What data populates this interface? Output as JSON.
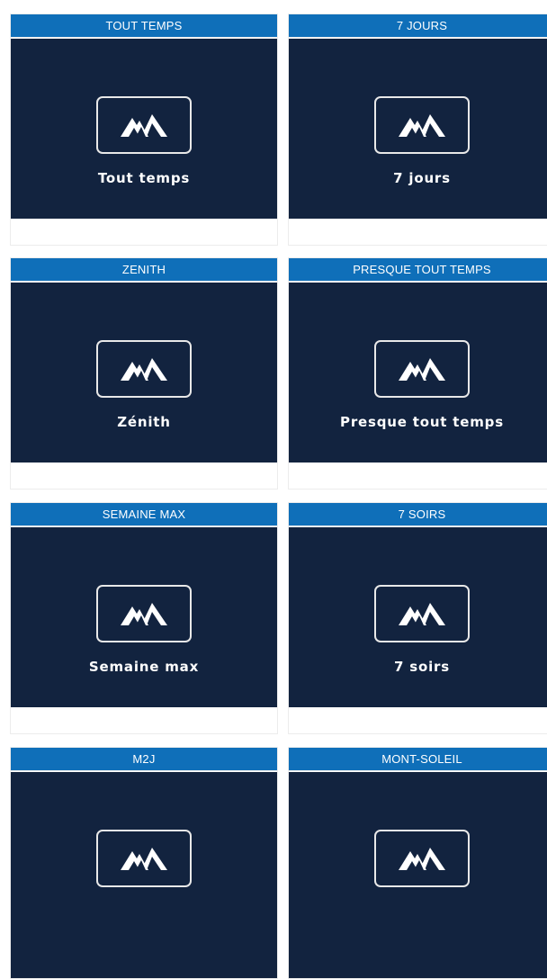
{
  "brand_colors": {
    "header": "#0f6fb9",
    "tile": "#12233f",
    "icon": "#ffffff"
  },
  "cards": [
    {
      "header": "TOUT TEMPS",
      "label": "Tout temps"
    },
    {
      "header": "7 JOURS",
      "label": "7 jours"
    },
    {
      "header": "ZENITH",
      "label": "Zénith"
    },
    {
      "header": "PRESQUE TOUT TEMPS",
      "label": "Presque tout temps"
    },
    {
      "header": "SEMAINE MAX",
      "label": "Semaine max"
    },
    {
      "header": "7 SOIRS",
      "label": "7 soirs"
    },
    {
      "header": "M2J",
      "label": ""
    },
    {
      "header": "MONT-SOLEIL",
      "label": ""
    }
  ],
  "icon_name": "mountain-logo-icon"
}
